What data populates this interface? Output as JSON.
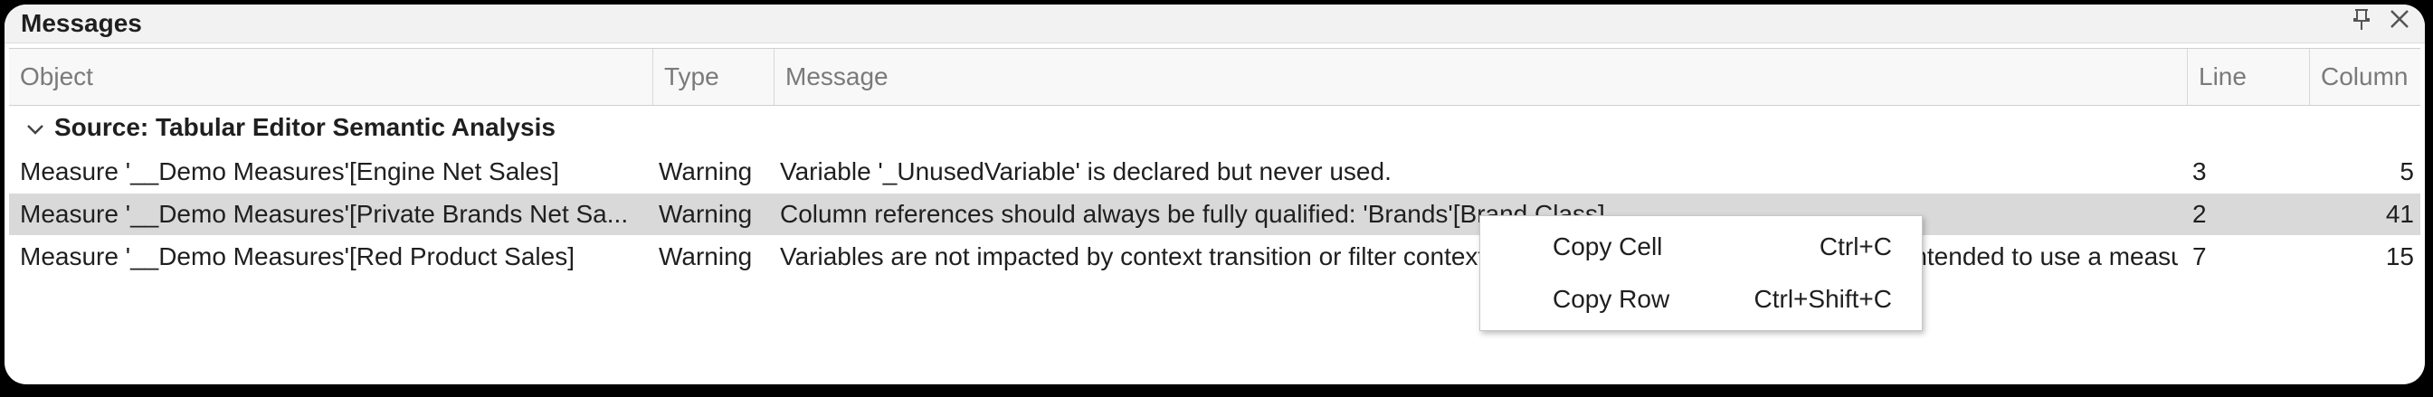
{
  "panel": {
    "title": "Messages",
    "pin_icon": "pin-icon",
    "close_icon": "close-icon"
  },
  "columns": [
    "Object",
    "Type",
    "Message",
    "Line",
    "Column"
  ],
  "group": {
    "label": "Source: Tabular Editor Semantic Analysis",
    "icon": "chevron-down-icon"
  },
  "rows": [
    {
      "object": "Measure '__Demo Measures'[Engine Net Sales]",
      "type": "Warning",
      "message": "Variable '_UnusedVariable' is declared but never used.",
      "line": "3",
      "column": "5"
    },
    {
      "object": "Measure '__Demo Measures'[Private Brands Net Sa...",
      "type": "Warning",
      "message": "Column references should always be fully qualified: 'Brands'[Brand Class]",
      "line": "2",
      "column": "41"
    },
    {
      "object": "Measure '__Demo Measures'[Red Product Sales]",
      "type": "Warning",
      "message": "Variables are not impacted by context transition or filter context modifications. Consider whether you intended to use a measure ref...",
      "line": "7",
      "column": "15"
    }
  ],
  "context_menu": {
    "items": [
      {
        "label": "Copy Cell",
        "shortcut": "Ctrl+C"
      },
      {
        "label": "Copy Row",
        "shortcut": "Ctrl+Shift+C"
      }
    ]
  },
  "colors": {
    "selected_row": "#d9d9d9",
    "header_bg": "#f8f8f8",
    "frame": "#000000"
  }
}
